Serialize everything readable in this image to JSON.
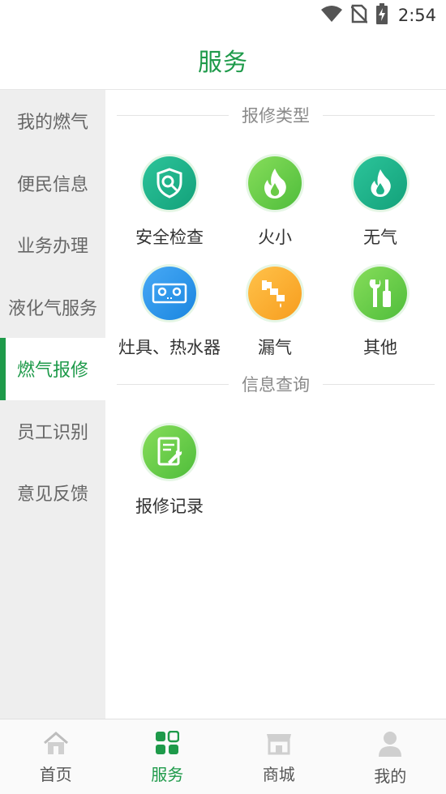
{
  "status_bar": {
    "time": "2:54"
  },
  "header": {
    "title": "服务"
  },
  "sidebar": {
    "items": [
      {
        "label": "我的燃气"
      },
      {
        "label": "便民信息"
      },
      {
        "label": "业务办理"
      },
      {
        "label": "液化气服务"
      },
      {
        "label": "燃气报修",
        "active": true
      },
      {
        "label": "员工识别"
      },
      {
        "label": "意见反馈"
      }
    ]
  },
  "sections": {
    "repair_types": {
      "title": "报修类型",
      "tiles": [
        {
          "label": "安全检查",
          "icon": "shield-search-icon"
        },
        {
          "label": "火小",
          "icon": "fire-icon"
        },
        {
          "label": "无气",
          "icon": "flame-icon"
        },
        {
          "label": "灶具、热水器",
          "icon": "stove-icon"
        },
        {
          "label": "漏气",
          "icon": "leaking-pipe-icon"
        },
        {
          "label": "其他",
          "icon": "tools-icon"
        }
      ]
    },
    "info_query": {
      "title": "信息查询",
      "tiles": [
        {
          "label": "报修记录",
          "icon": "repair-record-icon"
        }
      ]
    }
  },
  "bottom_nav": {
    "items": [
      {
        "label": "首页",
        "icon": "home-icon"
      },
      {
        "label": "服务",
        "icon": "grid-icon",
        "active": true
      },
      {
        "label": "商城",
        "icon": "store-icon"
      },
      {
        "label": "我的",
        "icon": "user-icon"
      }
    ]
  },
  "colors": {
    "accent": "#1e9a4a",
    "sidebar_bg": "#eeeeee"
  }
}
